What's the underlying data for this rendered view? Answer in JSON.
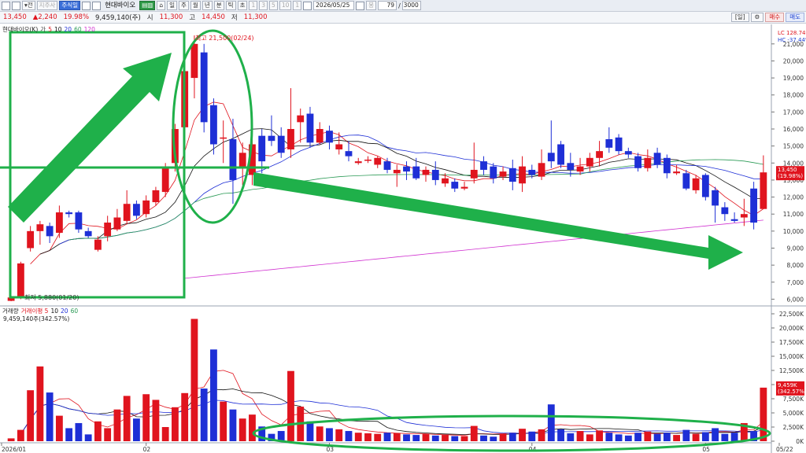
{
  "toolbar": {
    "period_buttons": [
      "주",
      "월",
      "년",
      "분",
      "틱",
      "초"
    ],
    "minute_buttons": [
      "1",
      "3",
      "5",
      "10",
      "1"
    ],
    "code": "지주사",
    "stock_name": "현대바이오",
    "chart_type_btn": "주식일",
    "date": "2026/05/25",
    "count_a": "79",
    "count_b": "3000"
  },
  "pricebar": {
    "price": "13,450",
    "change": "▲2,240",
    "change_pct": "19.98%",
    "volume": "9,459,140(주)",
    "open_label": "시",
    "open": "11,300",
    "high_label": "고",
    "high": "14,450",
    "low_label": "저",
    "low": "11,300",
    "btn_settings": "[일]",
    "btn_buy": "매수",
    "btn_sell": "매도"
  },
  "price_panel": {
    "title": "현대바이오(K)",
    "ma_label": "가",
    "ma_periods": [
      "5",
      "10",
      "20",
      "60",
      "120"
    ],
    "high_annotation": "최고 21,500(02/24)",
    "low_annotation": "최저 5,880(01/20)",
    "lc_label": "LC 128.74%",
    "hc_label": "HC -37.44%",
    "last_price_tag": "13,450",
    "last_pct_tag": "(19.98%)",
    "y_ticks": [
      "21,000",
      "20,000",
      "19,000",
      "18,000",
      "17,000",
      "16,000",
      "15,000",
      "14,000",
      "13,000",
      "12,000",
      "11,000",
      "10,000",
      "9,000",
      "8,000",
      "7,000",
      "6,000"
    ]
  },
  "volume_panel": {
    "title": "거래량",
    "ma_label": "거래이평 5",
    "ma_periods": [
      "10",
      "20",
      "60"
    ],
    "current": "9,459,140주(342.57%)",
    "last_tag_a": "9,459K",
    "last_tag_b": "(342.57%)",
    "y_ticks": [
      "22,500K",
      "20,000K",
      "17,500K",
      "15,000K",
      "12,500K",
      "10,000K",
      "7,500K",
      "5,000K",
      "2,500K",
      "0K"
    ]
  },
  "x_axis": {
    "labels": [
      "2026/01",
      "02",
      "03",
      "04",
      "05",
      "05/22"
    ]
  },
  "colors": {
    "up": "#e0141e",
    "down": "#1e2fd6",
    "annotation": "#1fb04a"
  },
  "chart_data": {
    "type": "candlestick",
    "price_range": [
      6000,
      21500
    ],
    "volume_range_k": [
      0,
      22500
    ],
    "candles": [
      {
        "o": 5900,
        "c": 6100,
        "h": 6200,
        "l": 5880,
        "v": 500
      },
      {
        "o": 6100,
        "c": 8100,
        "h": 8200,
        "l": 6000,
        "v": 2000
      },
      {
        "o": 9000,
        "c": 10000,
        "h": 10300,
        "l": 8800,
        "v": 9000
      },
      {
        "o": 10000,
        "c": 10400,
        "h": 10600,
        "l": 9200,
        "v": 13200
      },
      {
        "o": 10300,
        "c": 9700,
        "h": 10500,
        "l": 9300,
        "v": 8600
      },
      {
        "o": 9900,
        "c": 11100,
        "h": 11500,
        "l": 9600,
        "v": 4500
      },
      {
        "o": 11100,
        "c": 11000,
        "h": 11200,
        "l": 10800,
        "v": 2300
      },
      {
        "o": 11100,
        "c": 10100,
        "h": 11200,
        "l": 9900,
        "v": 3200
      },
      {
        "o": 10000,
        "c": 9700,
        "h": 10200,
        "l": 9600,
        "v": 1200
      },
      {
        "o": 8900,
        "c": 9500,
        "h": 9700,
        "l": 8800,
        "v": 3500
      },
      {
        "o": 9700,
        "c": 10500,
        "h": 10900,
        "l": 9400,
        "v": 2300
      },
      {
        "o": 10100,
        "c": 10800,
        "h": 11300,
        "l": 10000,
        "v": 5600
      },
      {
        "o": 10600,
        "c": 11600,
        "h": 12400,
        "l": 10400,
        "v": 8000
      },
      {
        "o": 11600,
        "c": 10900,
        "h": 11800,
        "l": 10700,
        "v": 4000
      },
      {
        "o": 11000,
        "c": 11800,
        "h": 12100,
        "l": 10800,
        "v": 8300
      },
      {
        "o": 11700,
        "c": 12400,
        "h": 12600,
        "l": 11500,
        "v": 7300
      },
      {
        "o": 12300,
        "c": 13800,
        "h": 14000,
        "l": 12000,
        "v": 2500
      },
      {
        "o": 14000,
        "c": 16000,
        "h": 16300,
        "l": 13500,
        "v": 6000
      },
      {
        "o": 16100,
        "c": 19400,
        "h": 20100,
        "l": 13900,
        "v": 8500
      },
      {
        "o": 19000,
        "c": 21000,
        "h": 21500,
        "l": 17800,
        "v": 21600
      },
      {
        "o": 20500,
        "c": 16400,
        "h": 21000,
        "l": 15800,
        "v": 9300
      },
      {
        "o": 17400,
        "c": 15100,
        "h": 17800,
        "l": 14500,
        "v": 16200
      },
      {
        "o": 15500,
        "c": 15500,
        "h": 16500,
        "l": 14000,
        "v": 7000
      },
      {
        "o": 15400,
        "c": 13000,
        "h": 16600,
        "l": 11600,
        "v": 5600
      },
      {
        "o": 13700,
        "c": 14600,
        "h": 15200,
        "l": 12700,
        "v": 4000
      },
      {
        "o": 13300,
        "c": 15100,
        "h": 15800,
        "l": 12700,
        "v": 4700
      },
      {
        "o": 15600,
        "c": 14100,
        "h": 16000,
        "l": 13400,
        "v": 2600
      },
      {
        "o": 15600,
        "c": 15300,
        "h": 16800,
        "l": 15000,
        "v": 1300
      },
      {
        "o": 15600,
        "c": 14600,
        "h": 16100,
        "l": 14300,
        "v": 1800
      },
      {
        "o": 14800,
        "c": 16000,
        "h": 18400,
        "l": 14300,
        "v": 12400
      },
      {
        "o": 16400,
        "c": 16800,
        "h": 17200,
        "l": 15200,
        "v": 6100
      },
      {
        "o": 16900,
        "c": 15200,
        "h": 17300,
        "l": 14900,
        "v": 3500
      },
      {
        "o": 15200,
        "c": 16000,
        "h": 16400,
        "l": 15100,
        "v": 2600
      },
      {
        "o": 15900,
        "c": 15200,
        "h": 16200,
        "l": 14800,
        "v": 2300
      },
      {
        "o": 14800,
        "c": 15100,
        "h": 15800,
        "l": 14500,
        "v": 2100
      },
      {
        "o": 14700,
        "c": 14400,
        "h": 15300,
        "l": 14100,
        "v": 1800
      },
      {
        "o": 14000,
        "c": 14100,
        "h": 14300,
        "l": 13900,
        "v": 1500
      },
      {
        "o": 14200,
        "c": 14200,
        "h": 14400,
        "l": 14000,
        "v": 1400
      },
      {
        "o": 13900,
        "c": 14300,
        "h": 14400,
        "l": 13700,
        "v": 1300
      },
      {
        "o": 14100,
        "c": 13600,
        "h": 14300,
        "l": 13400,
        "v": 1500
      },
      {
        "o": 13400,
        "c": 13600,
        "h": 13900,
        "l": 12600,
        "v": 1400
      },
      {
        "o": 13800,
        "c": 13500,
        "h": 14100,
        "l": 13000,
        "v": 1200
      },
      {
        "o": 13800,
        "c": 13100,
        "h": 14300,
        "l": 13000,
        "v": 1100
      },
      {
        "o": 13300,
        "c": 13600,
        "h": 13800,
        "l": 12900,
        "v": 1300
      },
      {
        "o": 13600,
        "c": 13000,
        "h": 14100,
        "l": 12700,
        "v": 1000
      },
      {
        "o": 12800,
        "c": 13100,
        "h": 13400,
        "l": 12600,
        "v": 1100
      },
      {
        "o": 12900,
        "c": 12500,
        "h": 13100,
        "l": 12300,
        "v": 900
      },
      {
        "o": 12500,
        "c": 12600,
        "h": 12900,
        "l": 12400,
        "v": 900
      },
      {
        "o": 13100,
        "c": 13600,
        "h": 15200,
        "l": 12800,
        "v": 2700
      },
      {
        "o": 14100,
        "c": 13600,
        "h": 14400,
        "l": 13300,
        "v": 1000
      },
      {
        "o": 13800,
        "c": 13100,
        "h": 14000,
        "l": 12800,
        "v": 800
      },
      {
        "o": 13200,
        "c": 13500,
        "h": 13800,
        "l": 13000,
        "v": 1300
      },
      {
        "o": 13700,
        "c": 12900,
        "h": 14200,
        "l": 12400,
        "v": 1500
      },
      {
        "o": 12800,
        "c": 13800,
        "h": 14400,
        "l": 12300,
        "v": 2200
      },
      {
        "o": 13600,
        "c": 13300,
        "h": 13900,
        "l": 13100,
        "v": 1700
      },
      {
        "o": 13200,
        "c": 14000,
        "h": 14800,
        "l": 13000,
        "v": 2100
      },
      {
        "o": 14600,
        "c": 14100,
        "h": 16500,
        "l": 13700,
        "v": 6500
      },
      {
        "o": 15100,
        "c": 13900,
        "h": 15300,
        "l": 13700,
        "v": 2100
      },
      {
        "o": 14000,
        "c": 13600,
        "h": 14600,
        "l": 13200,
        "v": 1400
      },
      {
        "o": 13500,
        "c": 13800,
        "h": 14300,
        "l": 13300,
        "v": 1800
      },
      {
        "o": 13800,
        "c": 14300,
        "h": 14600,
        "l": 13500,
        "v": 1200
      },
      {
        "o": 14300,
        "c": 14700,
        "h": 15300,
        "l": 13800,
        "v": 1900
      },
      {
        "o": 15400,
        "c": 14900,
        "h": 16100,
        "l": 14600,
        "v": 1500
      },
      {
        "o": 15500,
        "c": 14700,
        "h": 15700,
        "l": 14500,
        "v": 1200
      },
      {
        "o": 14700,
        "c": 14500,
        "h": 14900,
        "l": 14300,
        "v": 1000
      },
      {
        "o": 14400,
        "c": 13700,
        "h": 14600,
        "l": 13500,
        "v": 1500
      },
      {
        "o": 13700,
        "c": 14300,
        "h": 14800,
        "l": 13500,
        "v": 1700
      },
      {
        "o": 14600,
        "c": 13900,
        "h": 14900,
        "l": 13700,
        "v": 1300
      },
      {
        "o": 14300,
        "c": 13400,
        "h": 14500,
        "l": 13100,
        "v": 1500
      },
      {
        "o": 13400,
        "c": 13500,
        "h": 13900,
        "l": 13300,
        "v": 1100
      },
      {
        "o": 13400,
        "c": 12500,
        "h": 13600,
        "l": 12400,
        "v": 2000
      },
      {
        "o": 12400,
        "c": 13100,
        "h": 13300,
        "l": 12200,
        "v": 1300
      },
      {
        "o": 13300,
        "c": 12000,
        "h": 13400,
        "l": 11800,
        "v": 1600
      },
      {
        "o": 12400,
        "c": 11500,
        "h": 12600,
        "l": 10500,
        "v": 2300
      },
      {
        "o": 11400,
        "c": 11000,
        "h": 11700,
        "l": 10600,
        "v": 1300
      },
      {
        "o": 10700,
        "c": 10600,
        "h": 11100,
        "l": 10500,
        "v": 1500
      },
      {
        "o": 10800,
        "c": 11000,
        "h": 11900,
        "l": 10300,
        "v": 3200
      },
      {
        "o": 12500,
        "c": 10500,
        "h": 12900,
        "l": 10100,
        "v": 1800
      },
      {
        "o": 11300,
        "c": 13450,
        "h": 14450,
        "l": 11300,
        "v": 9459
      }
    ]
  }
}
